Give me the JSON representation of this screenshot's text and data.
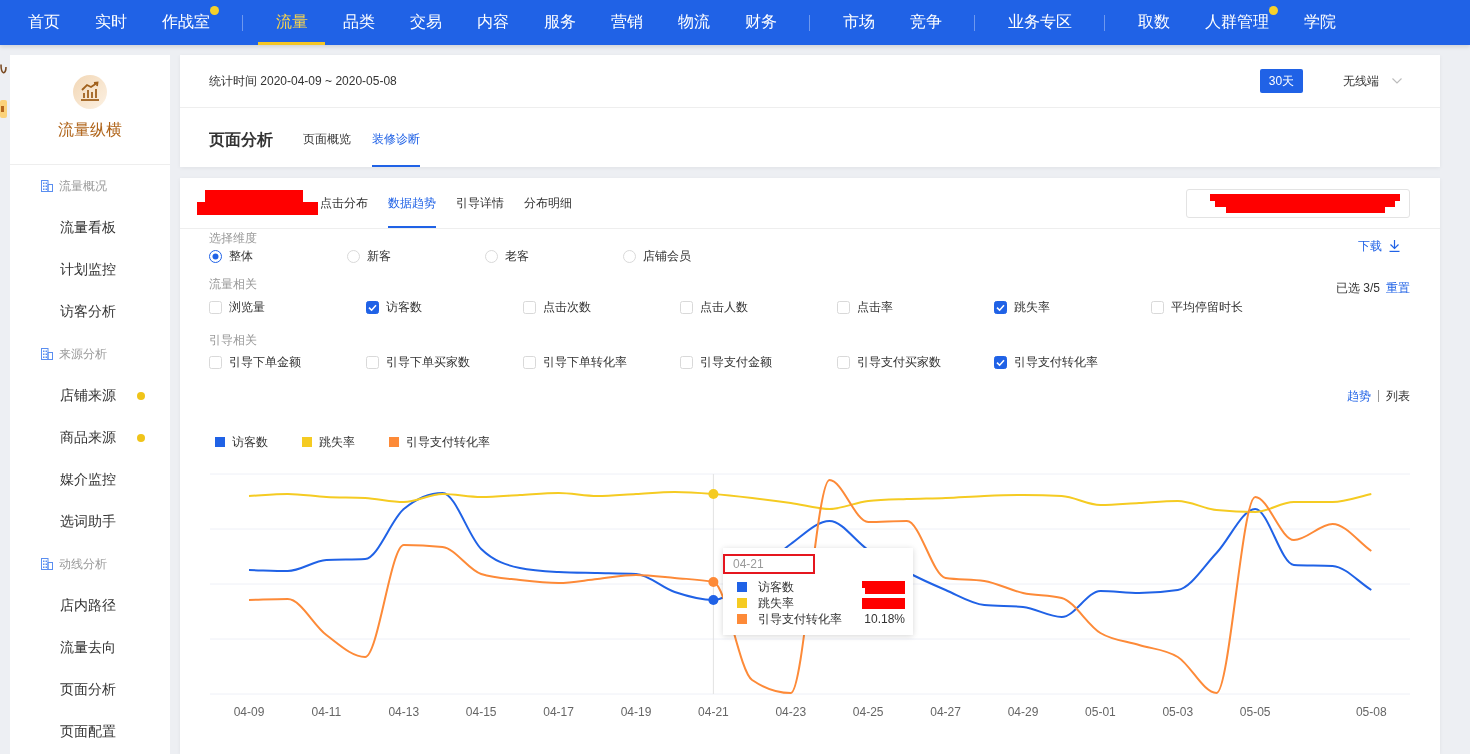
{
  "top_nav": {
    "groups": [
      {
        "items": [
          {
            "label": "首页",
            "selected": false,
            "dot": false
          },
          {
            "label": "实时",
            "selected": false,
            "dot": false
          },
          {
            "label": "作战室",
            "selected": false,
            "dot": true
          }
        ]
      },
      {
        "items": [
          {
            "label": "流量",
            "selected": true,
            "dot": false
          },
          {
            "label": "品类",
            "selected": false,
            "dot": false
          },
          {
            "label": "交易",
            "selected": false,
            "dot": false
          },
          {
            "label": "内容",
            "selected": false,
            "dot": false
          },
          {
            "label": "服务",
            "selected": false,
            "dot": false
          },
          {
            "label": "营销",
            "selected": false,
            "dot": false
          },
          {
            "label": "物流",
            "selected": false,
            "dot": false
          },
          {
            "label": "财务",
            "selected": false,
            "dot": false
          }
        ]
      },
      {
        "items": [
          {
            "label": "市场",
            "selected": false,
            "dot": false
          },
          {
            "label": "竞争",
            "selected": false,
            "dot": false
          }
        ]
      },
      {
        "items": [
          {
            "label": "业务专区",
            "selected": false,
            "dot": false
          }
        ]
      },
      {
        "items": [
          {
            "label": "取数",
            "selected": false,
            "dot": false
          },
          {
            "label": "人群管理",
            "selected": false,
            "dot": true
          },
          {
            "label": "学院",
            "selected": false,
            "dot": false
          }
        ]
      }
    ]
  },
  "sidebar": {
    "title": "流量纵横",
    "sections": [
      {
        "heading": "流量概况",
        "items": [
          {
            "label": "流量看板",
            "dot": false
          },
          {
            "label": "计划监控",
            "dot": false
          },
          {
            "label": "访客分析",
            "dot": false
          }
        ]
      },
      {
        "heading": "来源分析",
        "items": [
          {
            "label": "店铺来源",
            "dot": true
          },
          {
            "label": "商品来源",
            "dot": true
          },
          {
            "label": "媒介监控",
            "dot": false
          },
          {
            "label": "选词助手",
            "dot": false
          }
        ]
      },
      {
        "heading": "动线分析",
        "items": [
          {
            "label": "店内路径",
            "dot": false
          },
          {
            "label": "流量去向",
            "dot": false
          },
          {
            "label": "页面分析",
            "dot": false
          },
          {
            "label": "页面配置",
            "dot": false
          }
        ]
      }
    ]
  },
  "header": {
    "period": "统计时间 2020-04-09 ~ 2020-05-08",
    "range_button": "30天",
    "device_select": "无线端",
    "title": "页面分析",
    "tabs": [
      {
        "label": "页面概览",
        "selected": false
      },
      {
        "label": "装修诊断",
        "selected": true
      }
    ]
  },
  "analysis": {
    "tabs": [
      {
        "label": "点击分布",
        "selected": false
      },
      {
        "label": "数据趋势",
        "selected": true
      },
      {
        "label": "引导详情",
        "selected": false
      },
      {
        "label": "分布明细",
        "selected": false
      }
    ],
    "dimension": {
      "label": "选择维度",
      "options": [
        {
          "label": "整体",
          "selected": true
        },
        {
          "label": "新客",
          "selected": false
        },
        {
          "label": "老客",
          "selected": false
        },
        {
          "label": "店铺会员",
          "selected": false
        }
      ]
    },
    "download": "下载",
    "traffic_metrics": {
      "label": "流量相关",
      "selected_count": "已选 3/5",
      "reset": "重置",
      "options": [
        {
          "label": "浏览量",
          "checked": false
        },
        {
          "label": "访客数",
          "checked": true
        },
        {
          "label": "点击次数",
          "checked": false
        },
        {
          "label": "点击人数",
          "checked": false
        },
        {
          "label": "点击率",
          "checked": false
        },
        {
          "label": "跳失率",
          "checked": true
        },
        {
          "label": "平均停留时长",
          "checked": false
        }
      ]
    },
    "guide_metrics": {
      "label": "引导相关",
      "options": [
        {
          "label": "引导下单金额",
          "checked": false
        },
        {
          "label": "引导下单买家数",
          "checked": false
        },
        {
          "label": "引导下单转化率",
          "checked": false
        },
        {
          "label": "引导支付金额",
          "checked": false
        },
        {
          "label": "引导支付买家数",
          "checked": false
        },
        {
          "label": "引导支付转化率",
          "checked": true
        }
      ]
    },
    "view_toggle": [
      {
        "label": "趋势",
        "selected": true
      },
      {
        "label": "列表",
        "selected": false
      }
    ],
    "chart": {
      "legend": [
        {
          "label": "访客数",
          "color": "#2062e6"
        },
        {
          "label": "跳失率",
          "color": "#f5cb22"
        },
        {
          "label": "引导支付转化率",
          "color": "#fd8a38"
        }
      ],
      "x_labels": [
        "04-09",
        "04-11",
        "04-13",
        "04-15",
        "04-17",
        "04-19",
        "04-21",
        "04-23",
        "04-25",
        "04-27",
        "04-29",
        "05-01",
        "05-03",
        "05-05",
        "05-08"
      ],
      "tooltip": {
        "date": "04-21",
        "rows": [
          {
            "label": "访客数",
            "color": "#2062e6",
            "redacted": true
          },
          {
            "label": "跳失率",
            "color": "#f5cb22",
            "redacted": true
          },
          {
            "label": "引导支付转化率",
            "color": "#fd8a38",
            "redacted": false,
            "value": "10.18%"
          }
        ]
      }
    }
  }
}
